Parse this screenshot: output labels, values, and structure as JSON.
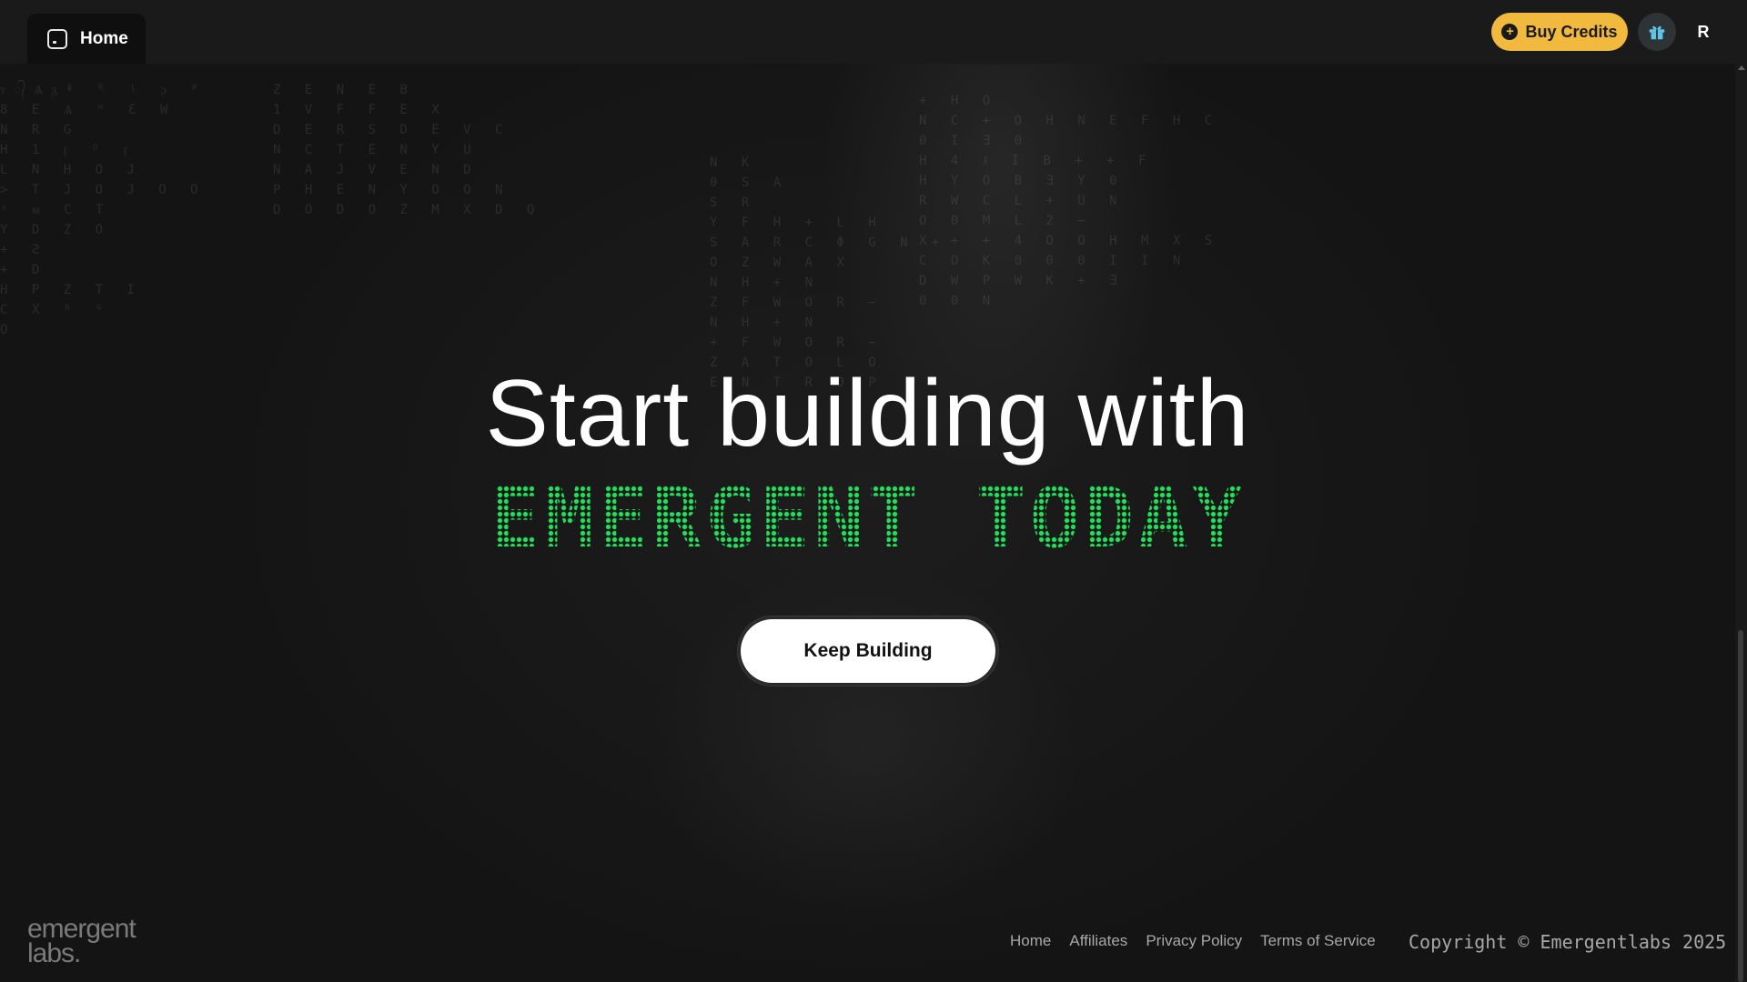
{
  "topbar": {
    "home_tab": {
      "label": "Home",
      "icon": "window-icon"
    },
    "buy_credits": {
      "label": "Buy Credits",
      "icon": "plus-circle-icon",
      "color": "#f1b93d"
    },
    "gift": {
      "icon": "gift-icon",
      "color": "#5ec6e8"
    },
    "avatar": {
      "initial": "R"
    }
  },
  "hero": {
    "title": "Start building with",
    "accent": "EMERGENT TODAY",
    "accent_color": "#22e05a",
    "cta_label": "Keep Building"
  },
  "background_matrix": {
    "left_block": "ᴛ᭄Ѧᵹᶲ ᴿ ᶪ ᶗ ᴻ\n8 E Ѧ ᴴ Ɛ W\nN R G\nH 1 ᶉ ᴼ ᶉ\nL N H O J\n> T J O J O O\nᶤ ᴍ C T\nY D Z O\n+ Ƨ\n+ D\nH P Z T I\nC X ᴮ ᴳ\nO",
    "mid_left_block": "Z E N E B\n1 V F F E X\nD E R S D E V C\nN C T E N Y U\nN A J V E N D\nP H E N Y O O N\nD O D O Z M X D Q",
    "mid_block": "N K\n0 S A\nS R\nY F H + L H\nS A R C Φ G N +\nO Z W A X\nN H + N\nZ F W O R −\nN H + N\n+ F W O R −\nZ A T O L O\nE N T R O P",
    "right_block": "+ H O\nN C + O H N E F H C\n0 I Ǝ 0\nH 4 Ɉ I B + + F\nH Y O B Ǝ Y 0\nR W C L + U N\nO 0 M L 2 −\nX + + 4 O O H M X S\nC O K 0 0 0 I I N\nD W P W K + Ǝ\n0 0 N"
  },
  "footer": {
    "logo_line1": "emergent",
    "logo_line2": "labs.",
    "links": [
      "Home",
      "Affiliates",
      "Privacy Policy",
      "Terms of Service"
    ],
    "copyright": "Copyright © Emergentlabs 2025"
  }
}
